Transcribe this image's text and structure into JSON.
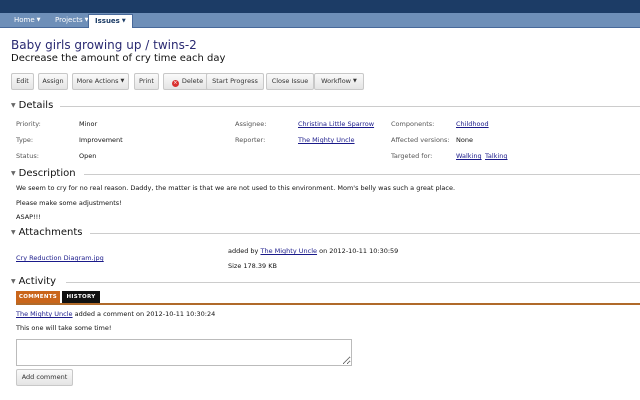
{
  "nav": {
    "tabs": [
      {
        "label": "Home"
      },
      {
        "label": "Projects"
      },
      {
        "label": "Issues"
      }
    ],
    "caret_glyph": "▼"
  },
  "issue": {
    "project": "Baby girls growing up",
    "separator": " / ",
    "key": "twins-2",
    "summary": "Decrease the amount of cry time each day"
  },
  "toolbar": {
    "edit": "Edit",
    "assign": "Assign",
    "more_actions": "More Actions",
    "print": "Print",
    "delete": "Delete",
    "delete_icon": "×",
    "start_progress": "Start Progress",
    "close_issue": "Close Issue",
    "workflow": "Workflow"
  },
  "sections": {
    "toggle_glyph": "▼",
    "details": "Details",
    "description": "Description",
    "attachments": "Attachments",
    "activity": "Activity"
  },
  "details": {
    "priority_label": "Priority:",
    "priority_value": "Minor",
    "type_label": "Type:",
    "type_value": "Improvement",
    "status_label": "Status:",
    "status_value": "Open",
    "assignee_label": "Assignee:",
    "assignee_value": "Christina Little Sparrow",
    "reporter_label": "Reporter:",
    "reporter_value": "The Mighty Uncle",
    "components_label": "Components:",
    "components_value": "Childhood",
    "affected_label": "Affected versions:",
    "affected_value": "None",
    "targeted_label": "Targeted for:",
    "targeted_values": [
      "Walking",
      "Talking"
    ]
  },
  "description": {
    "lines": [
      "We seem to cry for no real reason. Daddy, the matter is that we are not used to this environment. Mom's belly was such a great place.",
      "Please make some adjustments!",
      "ASAP!!!"
    ]
  },
  "attachment": {
    "filename": "Cry Reduction Diagram.jpg",
    "added_by_prefix": "added by",
    "added_by": "The Mighty Uncle",
    "added_on": "on 2012-10-11 10:30:59",
    "size": "Size 178.39 KB"
  },
  "activity": {
    "tab_comments": "COMMENTS",
    "tab_history": "HISTORY",
    "comment_author": "The Mighty Uncle",
    "comment_meta": "added a comment on 2012-10-11 10:30:24",
    "comment_text": "This one will take some time!",
    "comment_input_value": "",
    "add_comment_button": "Add comment"
  }
}
